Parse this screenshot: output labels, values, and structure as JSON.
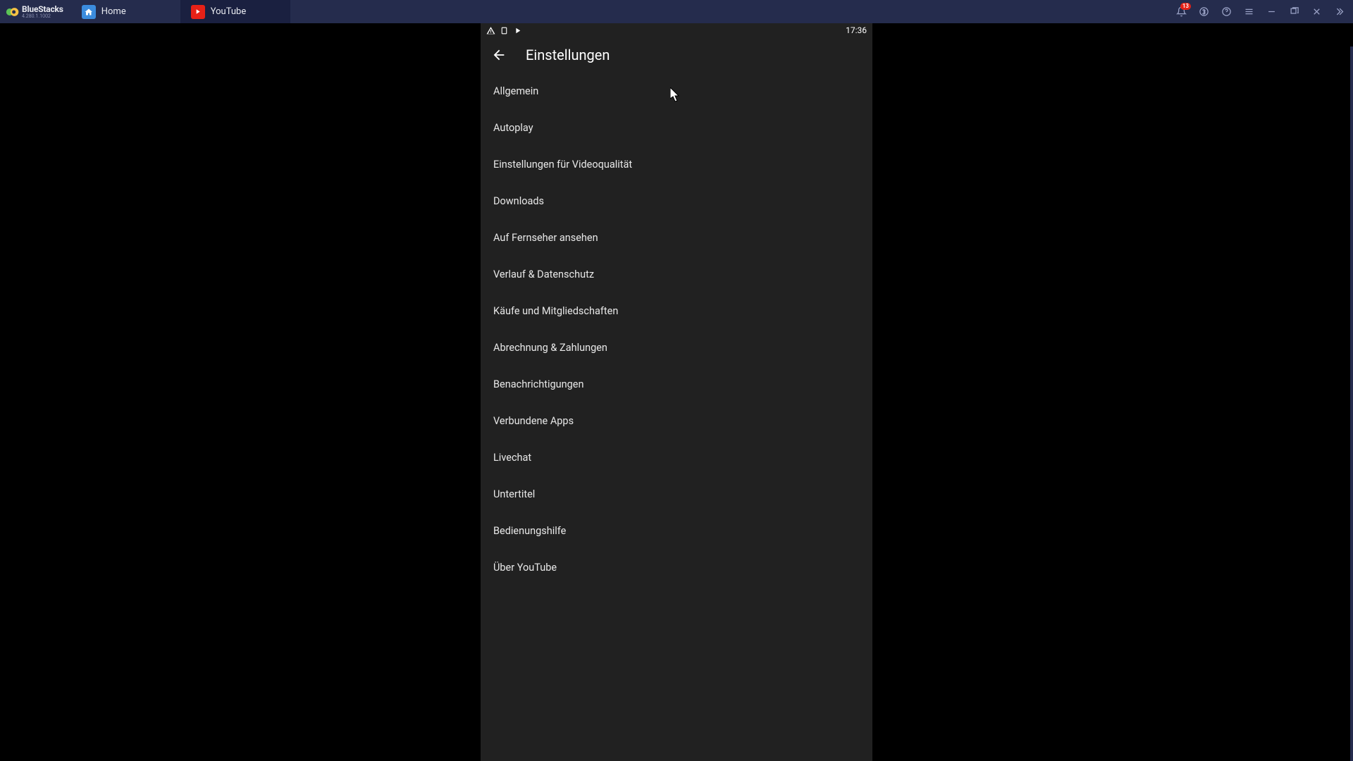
{
  "titlebar": {
    "brand": "BlueStacks",
    "version": "4.280.1.1002",
    "tabs": [
      {
        "id": "home",
        "label": "Home"
      },
      {
        "id": "youtube",
        "label": "YouTube"
      }
    ],
    "notif_count": "13"
  },
  "status_bar": {
    "time": "17:36"
  },
  "app_header": {
    "title": "Einstellungen"
  },
  "settings": {
    "items": [
      {
        "id": "general",
        "label": "Allgemein"
      },
      {
        "id": "autoplay",
        "label": "Autoplay"
      },
      {
        "id": "video-quality",
        "label": "Einstellungen für Videoqualität"
      },
      {
        "id": "downloads",
        "label": "Downloads"
      },
      {
        "id": "watch-on-tv",
        "label": "Auf Fernseher ansehen"
      },
      {
        "id": "history-privacy",
        "label": "Verlauf & Datenschutz"
      },
      {
        "id": "purchases",
        "label": "Käufe und Mitgliedschaften"
      },
      {
        "id": "billing",
        "label": "Abrechnung & Zahlungen"
      },
      {
        "id": "notifications",
        "label": "Benachrichtigungen"
      },
      {
        "id": "connected-apps",
        "label": "Verbundene Apps"
      },
      {
        "id": "livechat",
        "label": "Livechat"
      },
      {
        "id": "captions",
        "label": "Untertitel"
      },
      {
        "id": "accessibility",
        "label": "Bedienungshilfe"
      },
      {
        "id": "about",
        "label": "Über YouTube"
      }
    ]
  }
}
